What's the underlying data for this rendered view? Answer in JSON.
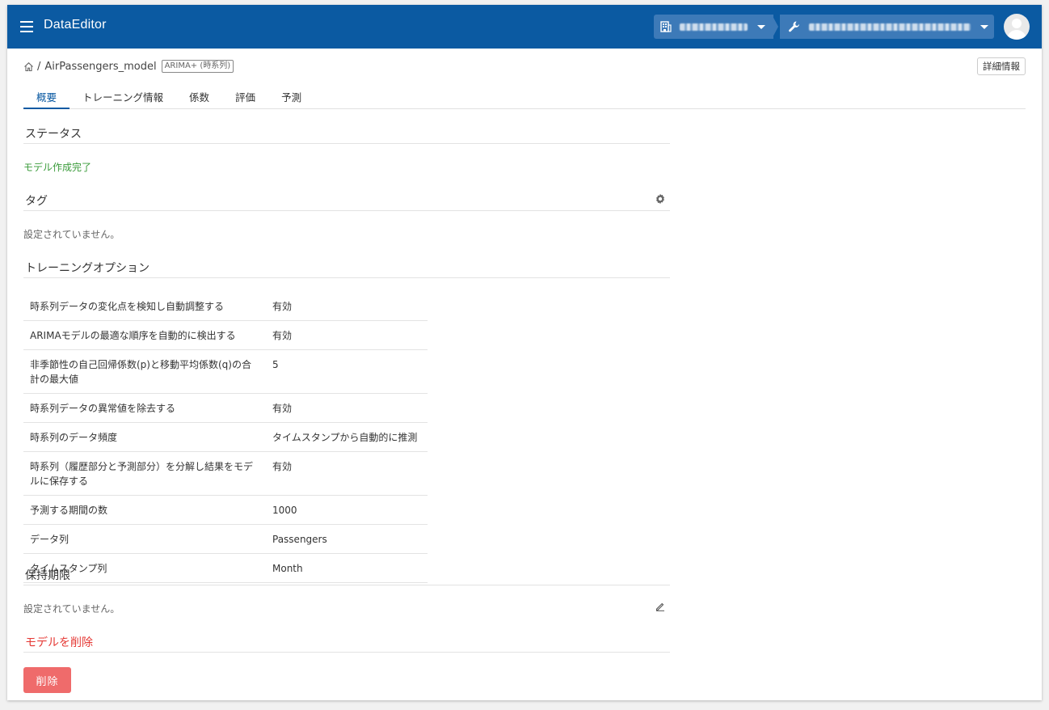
{
  "app": {
    "title": "DataEditor"
  },
  "breadcrumb": {
    "separator": "/",
    "model_name": "AirPassengers_model",
    "badge": "ARIMA+ (時系列)"
  },
  "header": {
    "detail_button": "詳細情報"
  },
  "tabs": [
    {
      "label": "概要",
      "active": true
    },
    {
      "label": "トレーニング情報"
    },
    {
      "label": "係数"
    },
    {
      "label": "評価"
    },
    {
      "label": "予測"
    }
  ],
  "status": {
    "title": "ステータス",
    "value": "モデル作成完了",
    "color": "#3a9b3a"
  },
  "tags": {
    "title": "タグ",
    "empty_text": "設定されていません。"
  },
  "training_options": {
    "title": "トレーニングオプション",
    "rows": [
      {
        "key": "時系列データの変化点を検知し自動調整する",
        "value": "有効"
      },
      {
        "key": "ARIMAモデルの最適な順序を自動的に検出する",
        "value": "有効"
      },
      {
        "key": "非季節性の自己回帰係数(p)と移動平均係数(q)の合計の最大値",
        "value": "5"
      },
      {
        "key": "時系列データの異常値を除去する",
        "value": "有効"
      },
      {
        "key": "時系列のデータ頻度",
        "value": "タイムスタンプから自動的に推測"
      },
      {
        "key": "時系列（履歴部分と予測部分）を分解し結果をモデルに保存する",
        "value": "有効"
      },
      {
        "key": "予測する期間の数",
        "value": "1000"
      },
      {
        "key": "データ列",
        "value": "Passengers"
      },
      {
        "key": "タイムスタンプ列",
        "value": "Month"
      }
    ]
  },
  "retention": {
    "title": "保持期限",
    "empty_text": "設定されていません。"
  },
  "danger": {
    "title": "モデルを削除",
    "delete_button": "削除",
    "color": "#e53935"
  },
  "colors": {
    "appbar": "#0b5aa2",
    "accent": "#0b5aa2",
    "delete": "#ef6b6b"
  }
}
